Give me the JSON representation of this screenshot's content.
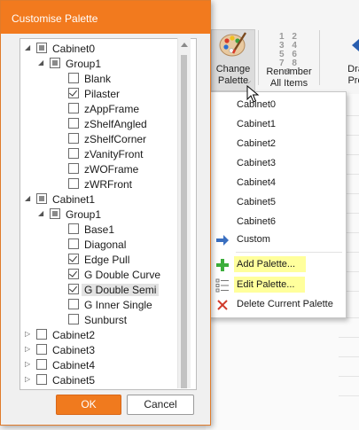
{
  "dialog": {
    "title": "Customise Palette",
    "ok_label": "OK",
    "cancel_label": "Cancel"
  },
  "tree": [
    {
      "label": "Cabinet0",
      "level": 0,
      "expanded": true,
      "state": "partial"
    },
    {
      "label": "Group1",
      "level": 1,
      "expanded": true,
      "state": "partial"
    },
    {
      "label": "Blank",
      "level": 2,
      "state": "unchecked"
    },
    {
      "label": "Pilaster",
      "level": 2,
      "state": "checked"
    },
    {
      "label": "zAppFrame",
      "level": 2,
      "state": "unchecked"
    },
    {
      "label": "zShelfAngled",
      "level": 2,
      "state": "unchecked"
    },
    {
      "label": "zShelfCorner",
      "level": 2,
      "state": "unchecked"
    },
    {
      "label": "zVanityFront",
      "level": 2,
      "state": "unchecked"
    },
    {
      "label": "zWOFrame",
      "level": 2,
      "state": "unchecked"
    },
    {
      "label": "zWRFront",
      "level": 2,
      "state": "unchecked"
    },
    {
      "label": "Cabinet1",
      "level": 0,
      "expanded": true,
      "state": "partial"
    },
    {
      "label": "Group1",
      "level": 1,
      "expanded": true,
      "state": "partial"
    },
    {
      "label": "Base1",
      "level": 2,
      "state": "unchecked"
    },
    {
      "label": "Diagonal",
      "level": 2,
      "state": "unchecked"
    },
    {
      "label": "Edge Pull",
      "level": 2,
      "state": "checked"
    },
    {
      "label": "G Double Curve",
      "level": 2,
      "state": "checked"
    },
    {
      "label": "G Double Semi",
      "level": 2,
      "state": "checked",
      "selected": true
    },
    {
      "label": "G Inner Single",
      "level": 2,
      "state": "unchecked"
    },
    {
      "label": "Sunburst",
      "level": 2,
      "state": "unchecked"
    },
    {
      "label": "Cabinet2",
      "level": 0,
      "expanded": false,
      "state": "unchecked"
    },
    {
      "label": "Cabinet3",
      "level": 0,
      "expanded": false,
      "state": "unchecked"
    },
    {
      "label": "Cabinet4",
      "level": 0,
      "expanded": false,
      "state": "unchecked"
    },
    {
      "label": "Cabinet5",
      "level": 0,
      "expanded": false,
      "state": "unchecked"
    }
  ],
  "ribbon": {
    "change_palette": "Change\nPalette",
    "renumber": "Renumber\nAll Items",
    "draw": "Dra\nPro",
    "renumber_icon_digits": "1 2 3 4 5 6 7 8 9"
  },
  "menu": {
    "palettes": [
      "Cabinet0",
      "Cabinet1",
      "Cabinet2",
      "Cabinet3",
      "Cabinet4",
      "Cabinet5",
      "Cabinet6"
    ],
    "custom": "Custom",
    "add_palette": "Add Palette...",
    "edit_palette": "Edit Palette...",
    "delete_palette": "Delete Current Palette"
  },
  "colors": {
    "accent": "#f27a1e",
    "highlight": "#ffff9c"
  }
}
